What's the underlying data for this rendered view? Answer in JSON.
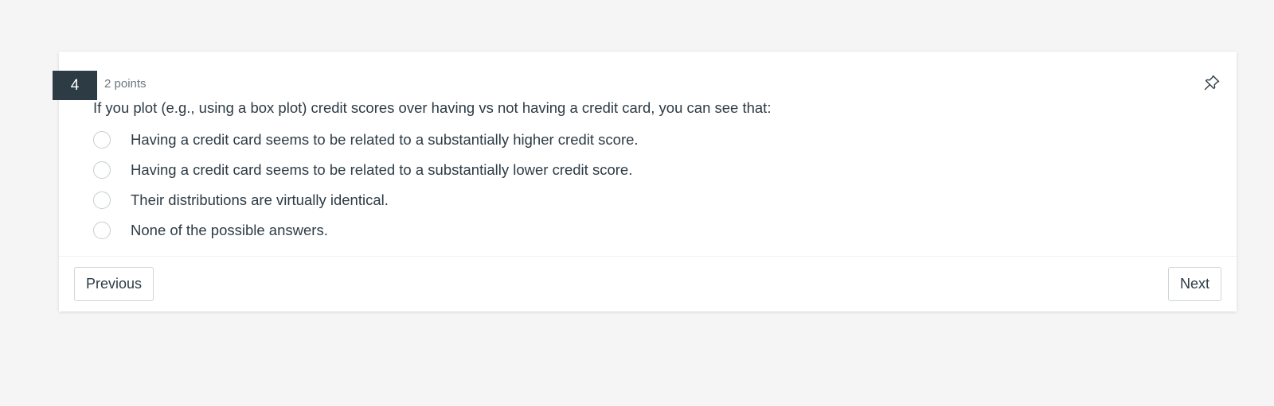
{
  "question": {
    "number": "4",
    "points": "2 points",
    "text": "If you plot (e.g., using a box plot) credit scores over having vs not having a credit card, you can see that:",
    "answers": [
      {
        "label": "Having a credit card seems to be related to a substantially higher credit score.",
        "selected": false
      },
      {
        "label": "Having a credit card seems to be related to a substantially lower credit score.",
        "selected": false
      },
      {
        "label": "Their distributions are virtually identical.",
        "selected": false
      },
      {
        "label": "None of the possible answers.",
        "selected": false
      }
    ]
  },
  "icons": {
    "pin": "pin-icon"
  },
  "footer": {
    "previous_label": "Previous",
    "next_label": "Next"
  },
  "colors": {
    "background": "#f5f5f5",
    "card": "#ffffff",
    "number_badge": "#2d3b45",
    "text": "#2d3b45",
    "muted_text": "#6b7780"
  }
}
